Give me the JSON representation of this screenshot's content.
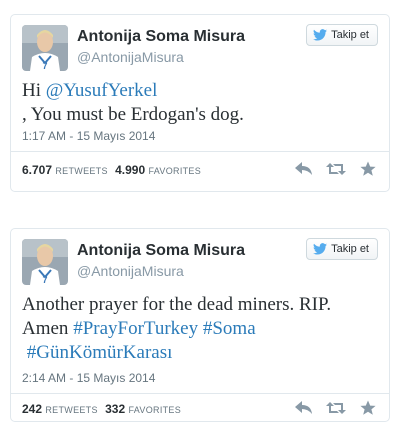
{
  "tweets": [
    {
      "author_name": "Antonija Soma Misura",
      "author_handle": "@AntonijaMisura",
      "follow_label": "Takip et",
      "text_parts": {
        "greeting": "Hi ",
        "mention": "@YusufYerkel",
        "body": " , You must be Erdogan's dog."
      },
      "timestamp": "1:17 AM - 15 Mayıs 2014",
      "retweets": "6.707",
      "retweets_label": "RETWEETS",
      "favorites": "4.990",
      "favorites_label": "FAVORITES"
    },
    {
      "author_name": "Antonija Soma Misura",
      "author_handle": "@AntonijaMisura",
      "follow_label": "Takip et",
      "text_parts": {
        "line1": "Another prayer for the dead miners. RIP.",
        "amen": "Amen ",
        "hashtag1": "#PrayForTurkey",
        "hashtag2": "#Soma",
        "hashtag3": "#GünKömürKarası"
      },
      "timestamp": "2:14 AM - 15 Mayıs 2014",
      "retweets": "242",
      "retweets_label": "RETWEETS",
      "favorites": "332",
      "favorites_label": "FAVORITES"
    }
  ],
  "colors": {
    "link": "#2b7bb9",
    "twitter_bird": "#55acee",
    "muted": "#66757f",
    "icon": "#8899a6"
  },
  "icons": [
    "twitter-bird-icon",
    "reply-icon",
    "retweet-icon",
    "favorite-star-icon"
  ]
}
